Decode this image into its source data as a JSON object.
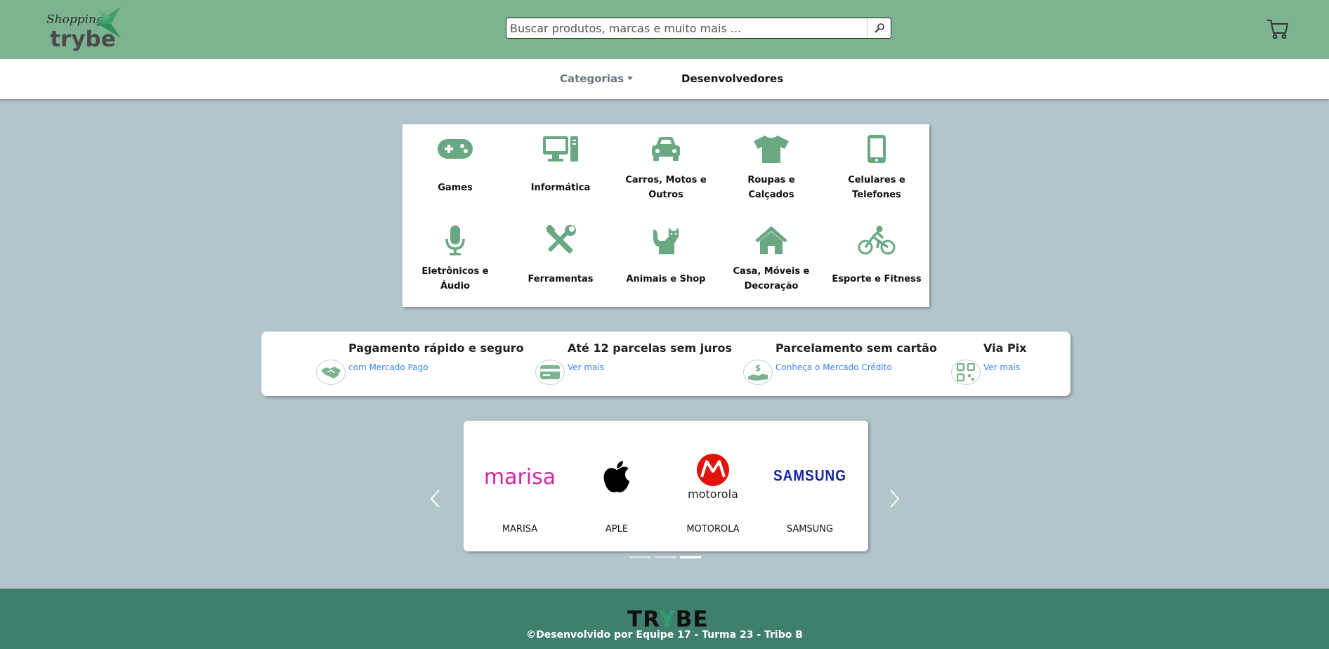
{
  "header": {
    "logo_script": "Shopping",
    "logo_brand": "trybe",
    "search_placeholder": "Buscar produtos, marcas e muito mais ..."
  },
  "nav": {
    "categories_label": "Categorias",
    "developers_label": "Desenvolvedores"
  },
  "categories": [
    {
      "label": "Games",
      "icon": "gamepad-icon"
    },
    {
      "label": "Informática",
      "icon": "computer-icon"
    },
    {
      "label": "Carros, Motos e Outros",
      "icon": "car-icon"
    },
    {
      "label": "Roupas e Calçados",
      "icon": "tshirt-icon"
    },
    {
      "label": "Celulares e Telefones",
      "icon": "mobile-phone-icon"
    },
    {
      "label": "Eletrônicos e Áudio",
      "icon": "microphone-icon"
    },
    {
      "label": "Ferramentas",
      "icon": "tools-icon"
    },
    {
      "label": "Animais e Shop",
      "icon": "cat-icon"
    },
    {
      "label": "Casa, Móveis e Decoração",
      "icon": "house-icon"
    },
    {
      "label": "Esporte e Fitness",
      "icon": "bicycle-icon"
    }
  ],
  "payments": [
    {
      "title": "Pagamento rápido e seguro",
      "link": "com Mercado Pago",
      "icon": "handshake-icon"
    },
    {
      "title": "Até 12 parcelas sem juros",
      "link": "Ver mais",
      "icon": "credit-card-icon"
    },
    {
      "title": "Parcelamento sem cartão",
      "link": "Conheça o Mercado Crédito",
      "icon": "money-hand-icon"
    },
    {
      "title": "Via Pix",
      "link": "Ver mais",
      "icon": "qr-code-icon"
    }
  ],
  "brands": [
    {
      "name": "MARISA",
      "logo_text": "marisa"
    },
    {
      "name": "APLE",
      "logo_text": ""
    },
    {
      "name": "MOTOROLA",
      "logo_text": "motorola"
    },
    {
      "name": "SAMSUNG",
      "logo_text": "SAMSUNG"
    }
  ],
  "carousel": {
    "slide_count": 3,
    "active_index": 2
  },
  "footer": {
    "logo_left": "TR",
    "logo_mid": "Y",
    "logo_right": "BE",
    "credit": "©Desenvolvido por Equipe 17 - Turma 23 - Tribo B"
  },
  "colors": {
    "header_bg": "#7db390",
    "accent": "#6aa883",
    "page_bg": "#b3c4cb",
    "footer_bg": "#3e7f6e",
    "link": "#3483fa"
  }
}
